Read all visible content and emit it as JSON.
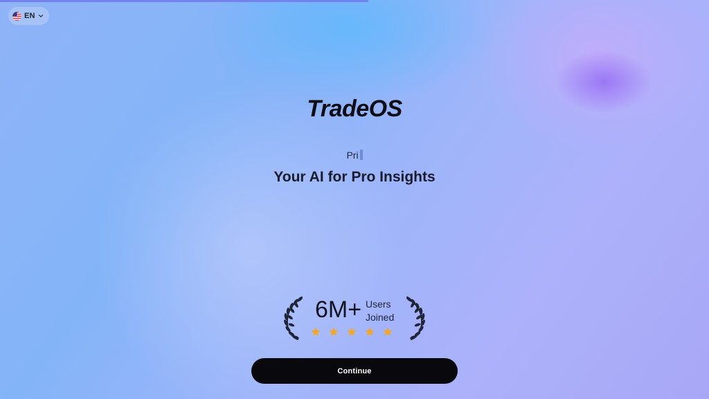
{
  "colors": {
    "accent": "#7382ee",
    "text_dark": "#0d0e14",
    "button_bg": "#09090d",
    "button_text": "#ffffff",
    "star": "#f5a623",
    "cursor_bar": "#6f8bd8"
  },
  "header": {
    "progress_fraction": 0.52,
    "language": {
      "flag_icon": "us-flag-icon",
      "label": "EN",
      "chevron_icon": "chevron-down-icon"
    }
  },
  "hero": {
    "logo_text": "TradeOS",
    "typing_text": "Pri",
    "tagline": "Your AI for Pro Insights"
  },
  "social_proof": {
    "count": "6M+",
    "label_line1": "Users",
    "label_line2": "Joined",
    "rating": 5,
    "star_icon": "star-icon",
    "laurel_icon": "laurel-icon"
  },
  "footer": {
    "continue_label": "Continue"
  }
}
